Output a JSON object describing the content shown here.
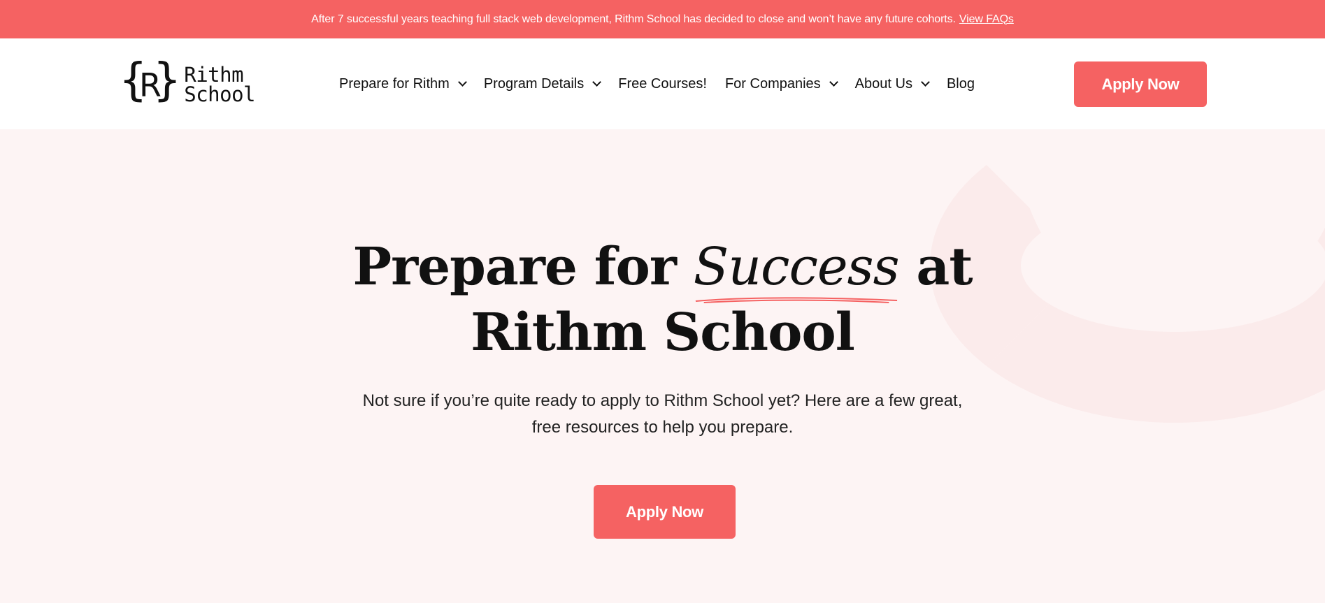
{
  "banner": {
    "text": "After 7 successful years teaching full stack web development, Rithm School has decided to close and won’t have any future cohorts.",
    "link": "View FAQs"
  },
  "logo": {
    "mark": "R",
    "line1": "Rithm",
    "line2": "School"
  },
  "nav": {
    "items": [
      {
        "label": "Prepare for Rithm",
        "dropdown": true
      },
      {
        "label": "Program Details",
        "dropdown": true
      },
      {
        "label": "Free Courses!",
        "dropdown": false
      },
      {
        "label": "For Companies",
        "dropdown": true
      },
      {
        "label": "About Us",
        "dropdown": true
      },
      {
        "label": "Blog",
        "dropdown": false
      }
    ],
    "apply_label": "Apply Now"
  },
  "hero": {
    "title_part1": "Prepare for ",
    "title_emphasis": "Success",
    "title_part2": " at",
    "title_line2": "Rithm School",
    "subtitle": "Not sure if you’re quite ready to apply to Rithm School yet? Here are a few great, free resources to help you prepare.",
    "button_label": "Apply Now"
  },
  "colors": {
    "accent": "#f56262",
    "background": "#fdf4f4"
  }
}
